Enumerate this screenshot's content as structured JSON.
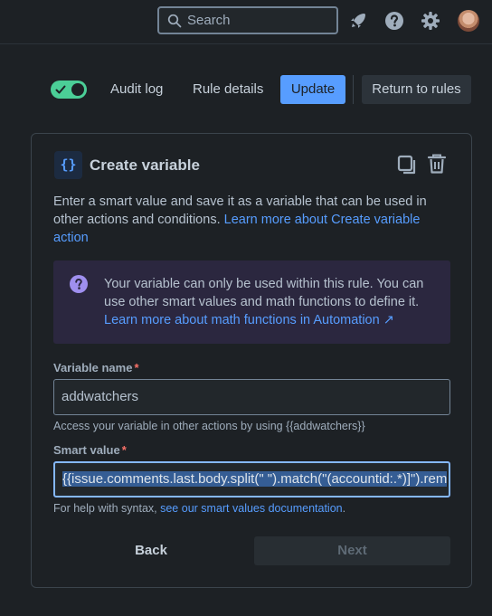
{
  "topbar": {
    "search_placeholder": "Search",
    "icons": [
      "search-icon",
      "notifications-rocket-icon",
      "help-icon",
      "settings-gear-icon",
      "avatar"
    ]
  },
  "actions": {
    "toggle_on": true,
    "audit_log": "Audit log",
    "rule_details": "Rule details",
    "update": "Update",
    "return_to_rules": "Return to rules"
  },
  "card": {
    "icon_glyph": "{}",
    "title": "Create variable",
    "description": "Enter a smart value and save it as a variable that can be used in other actions and conditions.",
    "description_link": "Learn more about Create variable action",
    "info_text": "Your variable can only be used within this rule. You can use other smart values and math functions to define it.",
    "info_link": "Learn more about math functions in Automation ↗",
    "variable_name_label": "Variable name",
    "variable_name_value": "addwatchers",
    "variable_name_hint": "Access your variable in other actions by using {{addwatchers}}",
    "smart_value_label": "Smart value",
    "smart_value_value": "{{issue.comments.last.body.split(\" \").match(\"(accountid:.*)]\").rem",
    "smart_value_hint_prefix": "For help with syntax, ",
    "smart_value_hint_link": "see our smart values documentation",
    "smart_value_hint_suffix": ".",
    "required_marker": "*",
    "back": "Back",
    "next": "Next"
  },
  "colors": {
    "background": "#1d2125",
    "accent": "#579dff",
    "toggle_on": "#4bce97",
    "info_bg": "#2b273f",
    "required": "#f87168"
  }
}
